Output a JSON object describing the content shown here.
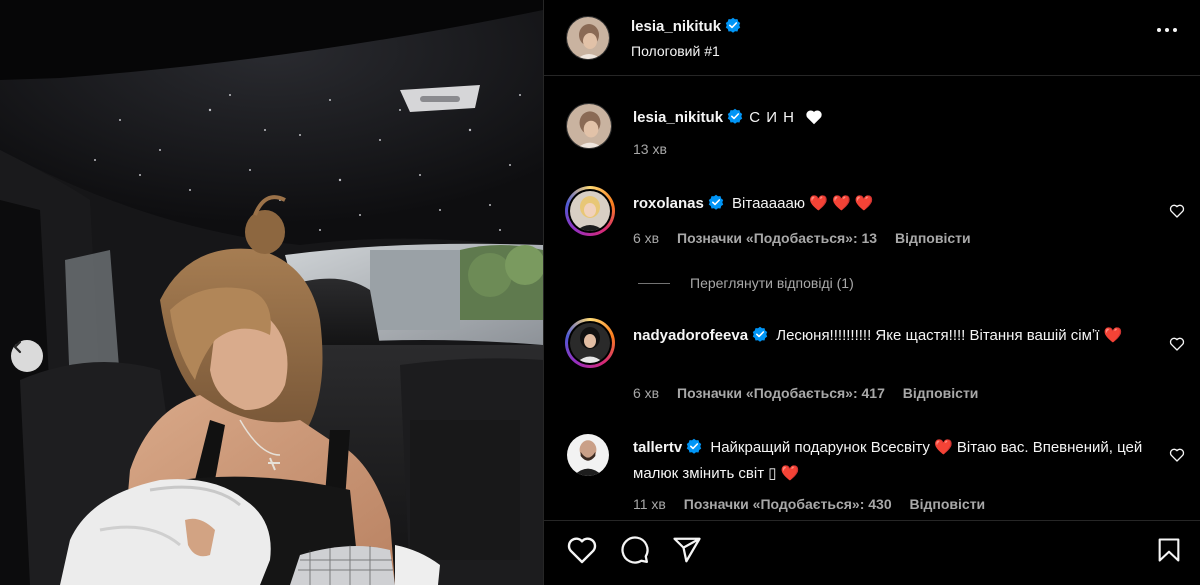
{
  "post": {
    "author": "lesia_nikituk",
    "location": "Пологовий #1",
    "caption": "С И Н",
    "caption_emoji": "white-heart",
    "caption_time": "13 хв"
  },
  "comments": [
    {
      "user": "roxolanas",
      "text": "Вітаааааю",
      "emoji": "❤️ ❤️ ❤️",
      "time": "6 хв",
      "likes_label": "Позначки «Подобається»: 13",
      "reply_label": "Відповісти"
    },
    {
      "user": "nadyadorofeeva",
      "text": "Лесюня!!!!!!!!!! Яке щастя!!!! Вітання вашій сімʼї",
      "emoji": "❤️",
      "time": "6 хв",
      "likes_label": "Позначки «Подобається»: 417",
      "reply_label": "Відповісти"
    },
    {
      "user": "tallertv",
      "text_a": "Найкращий подарунок Всесвіту",
      "text_b": "Вітаю вас. Впевнений, цей малюк змінить світ",
      "text_box": "▯",
      "emoji": "❤️",
      "time": "11 хв",
      "likes_label": "Позначки «Подобається»: 430",
      "reply_label": "Відповісти"
    }
  ],
  "view_replies_label": "Переглянути відповіді (1)",
  "icons": {
    "more": "more-horizontal-icon",
    "like": "heart-icon",
    "comment": "comment-icon",
    "share": "share-icon",
    "save": "bookmark-icon",
    "prev": "chevron-left-icon",
    "verified": "verified-badge-icon"
  },
  "colors": {
    "background": "#000000",
    "text": "#f5f5f5",
    "secondary": "#a8a8a8",
    "verified": "#0095f6",
    "heart": "#ff3040"
  }
}
